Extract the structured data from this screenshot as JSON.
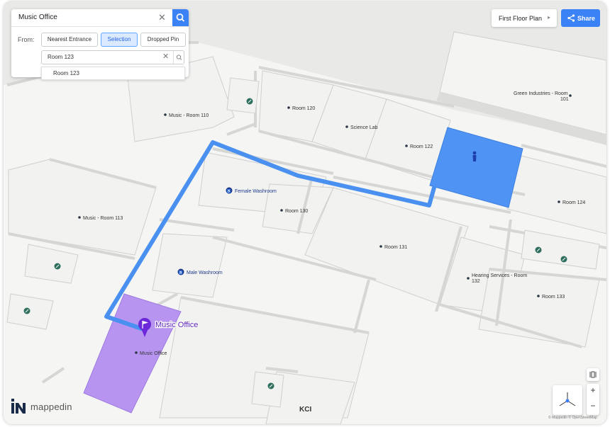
{
  "search": {
    "query": "Music Office"
  },
  "from": {
    "label": "From:",
    "options": [
      "Nearest Entrance",
      "Selection",
      "Dropped Pin"
    ],
    "selected": "Selection"
  },
  "origin_input": {
    "value": "Room 123"
  },
  "suggestions": [
    "Room 123"
  ],
  "floor_selector": {
    "label": "First Floor Plan"
  },
  "share": {
    "label": "Share"
  },
  "map_labels": {
    "music_room_110": "Music - Room 110",
    "room_120": "Room 120",
    "science_lab": "Science Lab",
    "room_122": "Room 122",
    "green_industries": "Green Industries - Room",
    "green_industries_2": "101",
    "music_room_113": "Music - Room 113",
    "female_washroom": "Female Washroom",
    "room_130": "Room 130",
    "room_124": "Room 124",
    "room_131": "Room 131",
    "male_washroom": "Male Washroom",
    "hearing_services": "Hearing Services - Room",
    "hearing_services_2": "132",
    "room_133": "Room 133",
    "music_office_marker": "Music Office",
    "music_office": "Music Office",
    "kci": "KCI"
  },
  "brand": {
    "name": "mappedin"
  },
  "attribution": "© Mappedin © OpenStreetMap",
  "colors": {
    "accent": "#3b82f6",
    "route": "#4a90f0",
    "destination": "#b794f0",
    "origin": "#4f94f5"
  },
  "icons": [
    "search-icon",
    "close-icon",
    "share-icon",
    "chevron-right-icon",
    "flag-pin-icon",
    "person-icon",
    "washroom-icon",
    "compass-icon",
    "zoom-in-icon",
    "zoom-out-icon"
  ]
}
